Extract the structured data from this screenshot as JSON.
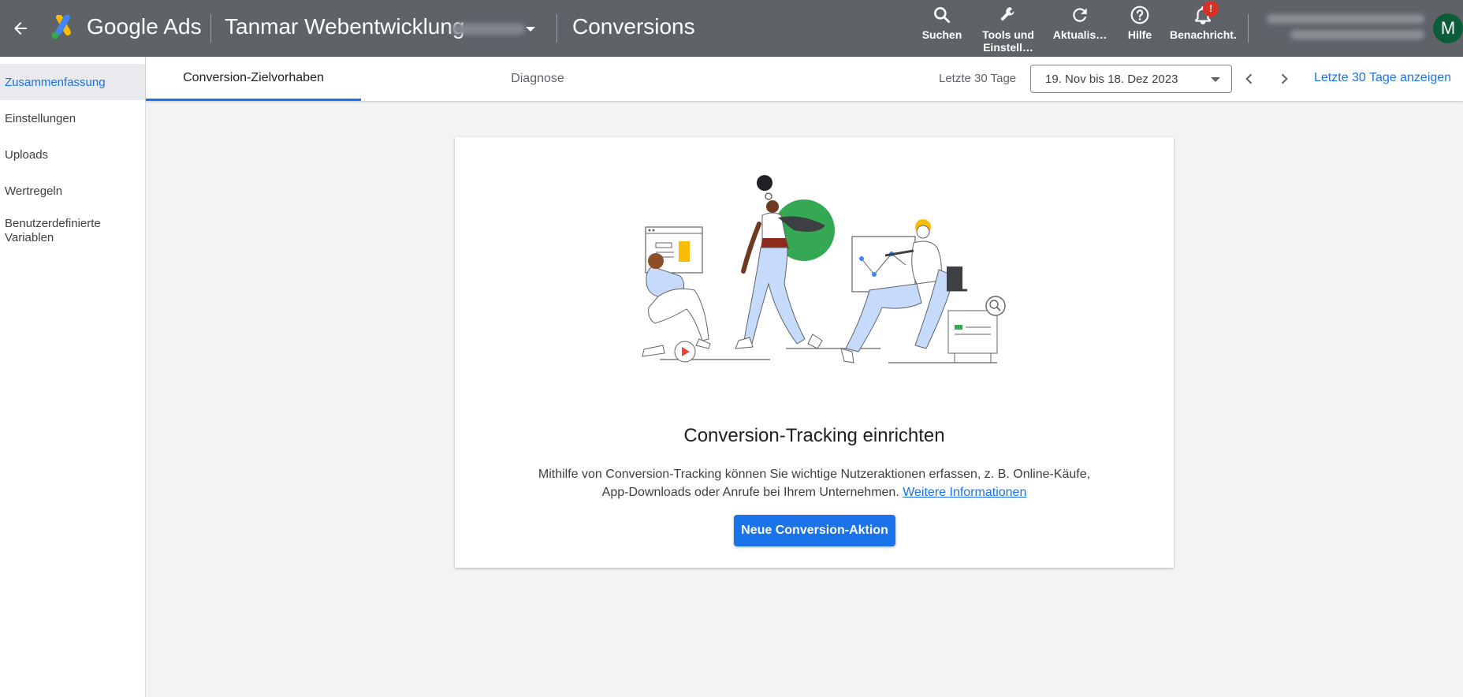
{
  "header": {
    "brand": "Google Ads",
    "account_name": "Tanmar Webentwicklung",
    "page_title": "Conversions",
    "tools": [
      {
        "label": "Suchen",
        "icon": "search-icon"
      },
      {
        "label": "Tools und Einstell…",
        "icon": "wrench-icon"
      },
      {
        "label": "Aktualis…",
        "icon": "refresh-icon"
      },
      {
        "label": "Hilfe",
        "icon": "help-icon"
      },
      {
        "label": "Benachricht.",
        "icon": "bell-icon",
        "badge": "!"
      }
    ],
    "avatar_initial": "M"
  },
  "sidebar": {
    "items": [
      {
        "label": "Zusammenfassung",
        "active": true
      },
      {
        "label": "Einstellungen"
      },
      {
        "label": "Uploads"
      },
      {
        "label": "Wertregeln"
      },
      {
        "label": "Benutzerdefinierte Variablen"
      }
    ]
  },
  "tabs": [
    {
      "label": "Conversion-Zielvorhaben",
      "active": true
    },
    {
      "label": "Diagnose"
    }
  ],
  "date_range": {
    "label": "Letzte 30 Tage",
    "value": "19. Nov bis 18. Dez 2023",
    "show_link": "Letzte 30 Tage anzeigen"
  },
  "empty_state": {
    "title": "Conversion-Tracking einrichten",
    "description_line1": "Mithilfe von Conversion-Tracking können Sie wichtige Nutzeraktionen erfassen, z. B. Online-Käufe,",
    "description_line2": "App-Downloads oder Anrufe bei Ihrem Unternehmen.",
    "learn_more": "Weitere Informationen",
    "button": "Neue Conversion-Aktion"
  },
  "colors": {
    "topbar": "#5f6368",
    "accent": "#1a73e8",
    "notification_badge": "#d93025",
    "avatar": "#0b5d3a"
  }
}
